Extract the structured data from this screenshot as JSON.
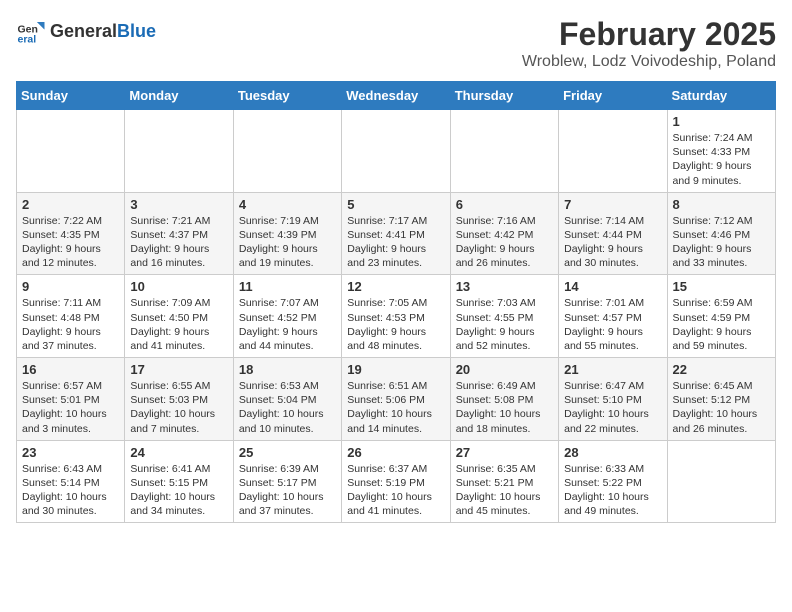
{
  "logo": {
    "general": "General",
    "blue": "Blue"
  },
  "header": {
    "month": "February 2025",
    "location": "Wroblew, Lodz Voivodeship, Poland"
  },
  "weekdays": [
    "Sunday",
    "Monday",
    "Tuesday",
    "Wednesday",
    "Thursday",
    "Friday",
    "Saturday"
  ],
  "weeks": [
    [
      {
        "day": "",
        "info": ""
      },
      {
        "day": "",
        "info": ""
      },
      {
        "day": "",
        "info": ""
      },
      {
        "day": "",
        "info": ""
      },
      {
        "day": "",
        "info": ""
      },
      {
        "day": "",
        "info": ""
      },
      {
        "day": "1",
        "info": "Sunrise: 7:24 AM\nSunset: 4:33 PM\nDaylight: 9 hours and 9 minutes."
      }
    ],
    [
      {
        "day": "2",
        "info": "Sunrise: 7:22 AM\nSunset: 4:35 PM\nDaylight: 9 hours and 12 minutes."
      },
      {
        "day": "3",
        "info": "Sunrise: 7:21 AM\nSunset: 4:37 PM\nDaylight: 9 hours and 16 minutes."
      },
      {
        "day": "4",
        "info": "Sunrise: 7:19 AM\nSunset: 4:39 PM\nDaylight: 9 hours and 19 minutes."
      },
      {
        "day": "5",
        "info": "Sunrise: 7:17 AM\nSunset: 4:41 PM\nDaylight: 9 hours and 23 minutes."
      },
      {
        "day": "6",
        "info": "Sunrise: 7:16 AM\nSunset: 4:42 PM\nDaylight: 9 hours and 26 minutes."
      },
      {
        "day": "7",
        "info": "Sunrise: 7:14 AM\nSunset: 4:44 PM\nDaylight: 9 hours and 30 minutes."
      },
      {
        "day": "8",
        "info": "Sunrise: 7:12 AM\nSunset: 4:46 PM\nDaylight: 9 hours and 33 minutes."
      }
    ],
    [
      {
        "day": "9",
        "info": "Sunrise: 7:11 AM\nSunset: 4:48 PM\nDaylight: 9 hours and 37 minutes."
      },
      {
        "day": "10",
        "info": "Sunrise: 7:09 AM\nSunset: 4:50 PM\nDaylight: 9 hours and 41 minutes."
      },
      {
        "day": "11",
        "info": "Sunrise: 7:07 AM\nSunset: 4:52 PM\nDaylight: 9 hours and 44 minutes."
      },
      {
        "day": "12",
        "info": "Sunrise: 7:05 AM\nSunset: 4:53 PM\nDaylight: 9 hours and 48 minutes."
      },
      {
        "day": "13",
        "info": "Sunrise: 7:03 AM\nSunset: 4:55 PM\nDaylight: 9 hours and 52 minutes."
      },
      {
        "day": "14",
        "info": "Sunrise: 7:01 AM\nSunset: 4:57 PM\nDaylight: 9 hours and 55 minutes."
      },
      {
        "day": "15",
        "info": "Sunrise: 6:59 AM\nSunset: 4:59 PM\nDaylight: 9 hours and 59 minutes."
      }
    ],
    [
      {
        "day": "16",
        "info": "Sunrise: 6:57 AM\nSunset: 5:01 PM\nDaylight: 10 hours and 3 minutes."
      },
      {
        "day": "17",
        "info": "Sunrise: 6:55 AM\nSunset: 5:03 PM\nDaylight: 10 hours and 7 minutes."
      },
      {
        "day": "18",
        "info": "Sunrise: 6:53 AM\nSunset: 5:04 PM\nDaylight: 10 hours and 10 minutes."
      },
      {
        "day": "19",
        "info": "Sunrise: 6:51 AM\nSunset: 5:06 PM\nDaylight: 10 hours and 14 minutes."
      },
      {
        "day": "20",
        "info": "Sunrise: 6:49 AM\nSunset: 5:08 PM\nDaylight: 10 hours and 18 minutes."
      },
      {
        "day": "21",
        "info": "Sunrise: 6:47 AM\nSunset: 5:10 PM\nDaylight: 10 hours and 22 minutes."
      },
      {
        "day": "22",
        "info": "Sunrise: 6:45 AM\nSunset: 5:12 PM\nDaylight: 10 hours and 26 minutes."
      }
    ],
    [
      {
        "day": "23",
        "info": "Sunrise: 6:43 AM\nSunset: 5:14 PM\nDaylight: 10 hours and 30 minutes."
      },
      {
        "day": "24",
        "info": "Sunrise: 6:41 AM\nSunset: 5:15 PM\nDaylight: 10 hours and 34 minutes."
      },
      {
        "day": "25",
        "info": "Sunrise: 6:39 AM\nSunset: 5:17 PM\nDaylight: 10 hours and 37 minutes."
      },
      {
        "day": "26",
        "info": "Sunrise: 6:37 AM\nSunset: 5:19 PM\nDaylight: 10 hours and 41 minutes."
      },
      {
        "day": "27",
        "info": "Sunrise: 6:35 AM\nSunset: 5:21 PM\nDaylight: 10 hours and 45 minutes."
      },
      {
        "day": "28",
        "info": "Sunrise: 6:33 AM\nSunset: 5:22 PM\nDaylight: 10 hours and 49 minutes."
      },
      {
        "day": "",
        "info": ""
      }
    ]
  ]
}
